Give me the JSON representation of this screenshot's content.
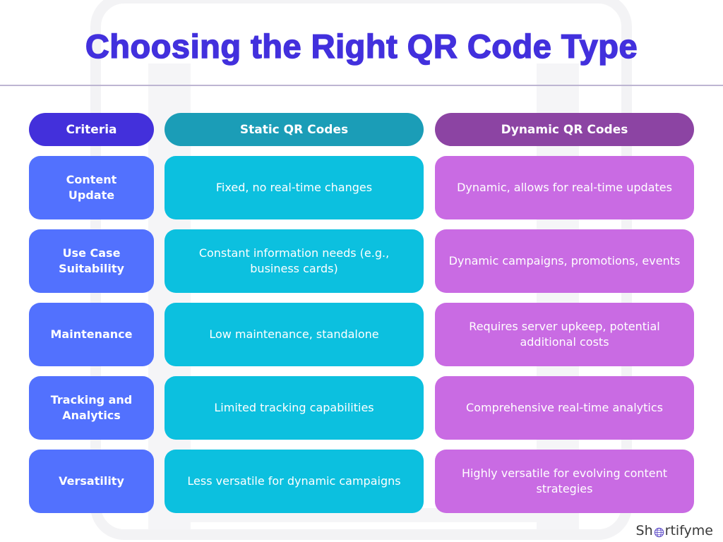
{
  "title": "Choosing the Right QR Code Type",
  "colors": {
    "title": "#4230dd",
    "criteria_header": "#4330db",
    "static_header": "#1b9db7",
    "dynamic_header": "#8c44a3",
    "criteria_cell": "#5271fe",
    "static_cell": "#0cc0df",
    "dynamic_cell": "#c96be3"
  },
  "table": {
    "headers": [
      "Criteria",
      "Static QR Codes",
      "Dynamic QR Codes"
    ],
    "rows": [
      {
        "criteria": "Content Update",
        "static": "Fixed, no real-time changes",
        "dynamic": "Dynamic, allows for real-time updates"
      },
      {
        "criteria": "Use Case Suitability",
        "static": "Constant information needs (e.g., business cards)",
        "dynamic": "Dynamic campaigns, promotions, events"
      },
      {
        "criteria": "Maintenance",
        "static": "Low maintenance, standalone",
        "dynamic": "Requires server upkeep, potential additional costs"
      },
      {
        "criteria": "Tracking and Analytics",
        "static": "Limited tracking capabilities",
        "dynamic": "Comprehensive real-time analytics"
      },
      {
        "criteria": "Versatility",
        "static": "Less versatile for dynamic campaigns",
        "dynamic": "Highly versatile for evolving content strategies"
      }
    ]
  },
  "brand": {
    "prefix": "Sh",
    "suffix": "rtifyme",
    "icon": "globe-icon"
  }
}
